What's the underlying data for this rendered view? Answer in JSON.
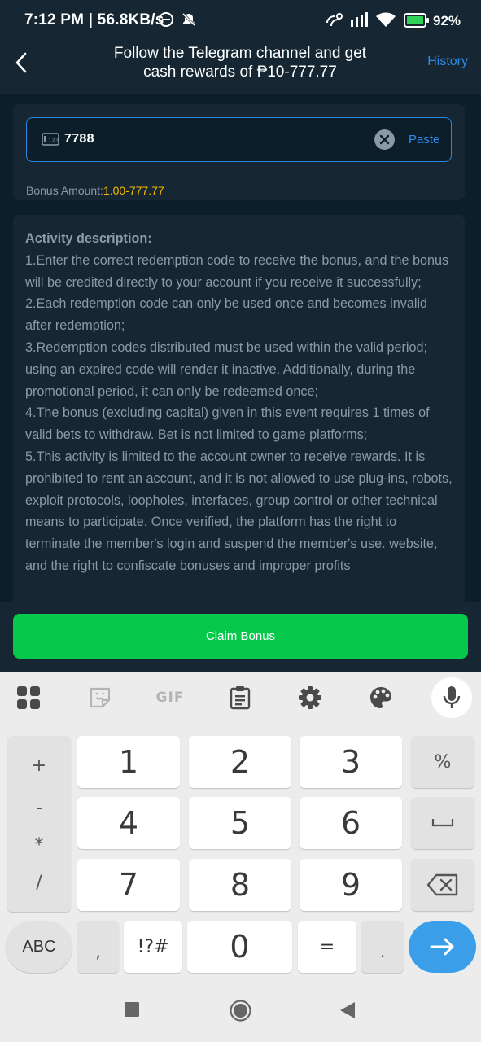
{
  "status_bar": {
    "time": "7:12 PM | 56.8KB/s",
    "battery": "92%",
    "icons": [
      "dnd-icon",
      "mute-icon",
      "vo-wifi-icon",
      "signal-icon",
      "wifi-icon",
      "battery-icon"
    ]
  },
  "header": {
    "title_line1": "Follow the Telegram channel and get",
    "title_line2": "cash rewards of ₱10-777.77",
    "history": "History"
  },
  "redeem": {
    "code_value": "7788",
    "paste": "Paste",
    "bonus_label": "Bonus Amount:",
    "bonus_range": "1.00-777.77"
  },
  "description": {
    "title": "Activity description:",
    "items": [
      "1.Enter the correct redemption code to receive the bonus, and the bonus will be credited directly to your account if you receive it successfully;",
      "2.Each redemption code can only be used once and becomes invalid after redemption;",
      "3.Redemption codes distributed must be used within the valid period; using an expired code will render it inactive. Additionally, during the promotional period, it can only be redeemed once;",
      "4.The bonus (excluding capital) given in this event requires 1 times of valid bets to withdraw. Bet is not limited to game platforms;",
      "5.This activity is limited to the account owner to receive rewards. It is prohibited to rent an account, and it is not allowed to use plug-ins, robots, exploit protocols, loopholes, interfaces, group control or other technical means to participate. Once verified, the platform has the right to terminate the member's login and suspend the member's use. website, and the right to confiscate bonuses and improper profits"
    ]
  },
  "claim": {
    "label": "Claim Bonus"
  },
  "keyboard": {
    "toolbar": [
      "apps-icon",
      "sticker-icon",
      "gif-icon",
      "clipboard-icon",
      "settings-icon",
      "theme-icon",
      "mic-icon"
    ],
    "gif_label": "GIF",
    "digits": [
      "1",
      "2",
      "3",
      "4",
      "5",
      "6",
      "7",
      "8",
      "9",
      "0"
    ],
    "symbols": [
      "+",
      "-",
      "*",
      "/"
    ],
    "percent": "%",
    "abc": "ABC",
    "comma": ",",
    "sym": "!?#",
    "equals": "=",
    "period": "."
  },
  "colors": {
    "background": "#0d1e2b",
    "card": "#162733",
    "accent_blue": "#2f8be8",
    "bonus_yellow": "#f5b800",
    "claim_green": "#06c94b"
  }
}
